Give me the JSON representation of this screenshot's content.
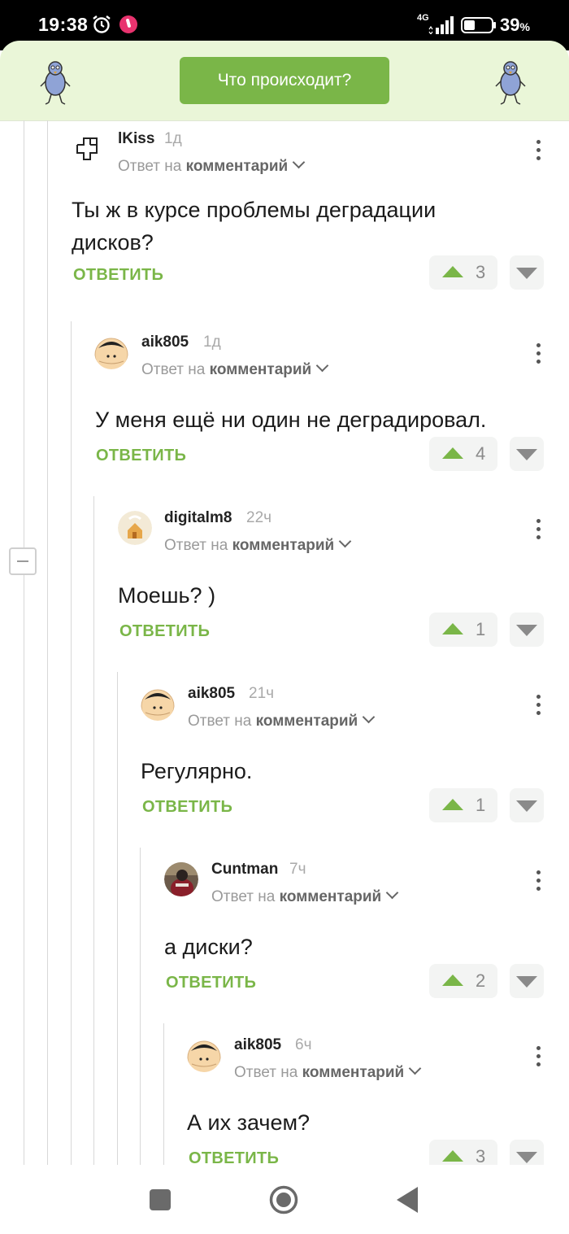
{
  "status_bar": {
    "time": "19:38",
    "network": "4G",
    "battery": "39",
    "battery_unit": "%"
  },
  "header": {
    "button_label": "Что происходит?",
    "accent_color": "#7ab648",
    "background_color": "#eaf6d8"
  },
  "comments": [
    {
      "author": "lKiss",
      "time": "1д",
      "reply_prefix": "Ответ на",
      "reply_target": "комментарий",
      "text": "Ты ж в курсе проблемы деградации дисков?",
      "answer_label": "ОТВЕТИТЬ",
      "votes": "3",
      "avatar": "rammstein-cross-icon"
    },
    {
      "author": "aik805",
      "time": "1д",
      "reply_prefix": "Ответ на",
      "reply_target": "комментарий",
      "text": "У меня ещё ни один не деградировал.",
      "answer_label": "ОТВЕТИТЬ",
      "votes": "4",
      "avatar": "cartoon-face-icon"
    },
    {
      "author": "digitalm8",
      "time": "22ч",
      "reply_prefix": "Ответ на",
      "reply_target": "комментарий",
      "text": "Моешь? )",
      "answer_label": "ОТВЕТИТЬ",
      "votes": "1",
      "avatar": "house-icon"
    },
    {
      "author": "aik805",
      "time": "21ч",
      "reply_prefix": "Ответ на",
      "reply_target": "комментарий",
      "text": "Регулярно.",
      "answer_label": "ОТВЕТИТЬ",
      "votes": "1",
      "avatar": "cartoon-face-icon"
    },
    {
      "author": "Cuntman",
      "time": "7ч",
      "reply_prefix": "Ответ на",
      "reply_target": "комментарий",
      "text": "а диски?",
      "answer_label": "ОТВЕТИТЬ",
      "votes": "2",
      "avatar": "photo-avatar"
    },
    {
      "author": "aik805",
      "time": "6ч",
      "reply_prefix": "Ответ на",
      "reply_target": "комментарий",
      "text": "А их зачем?",
      "answer_label": "ОТВЕТИТЬ",
      "votes": "3",
      "avatar": "cartoon-face-icon"
    }
  ]
}
